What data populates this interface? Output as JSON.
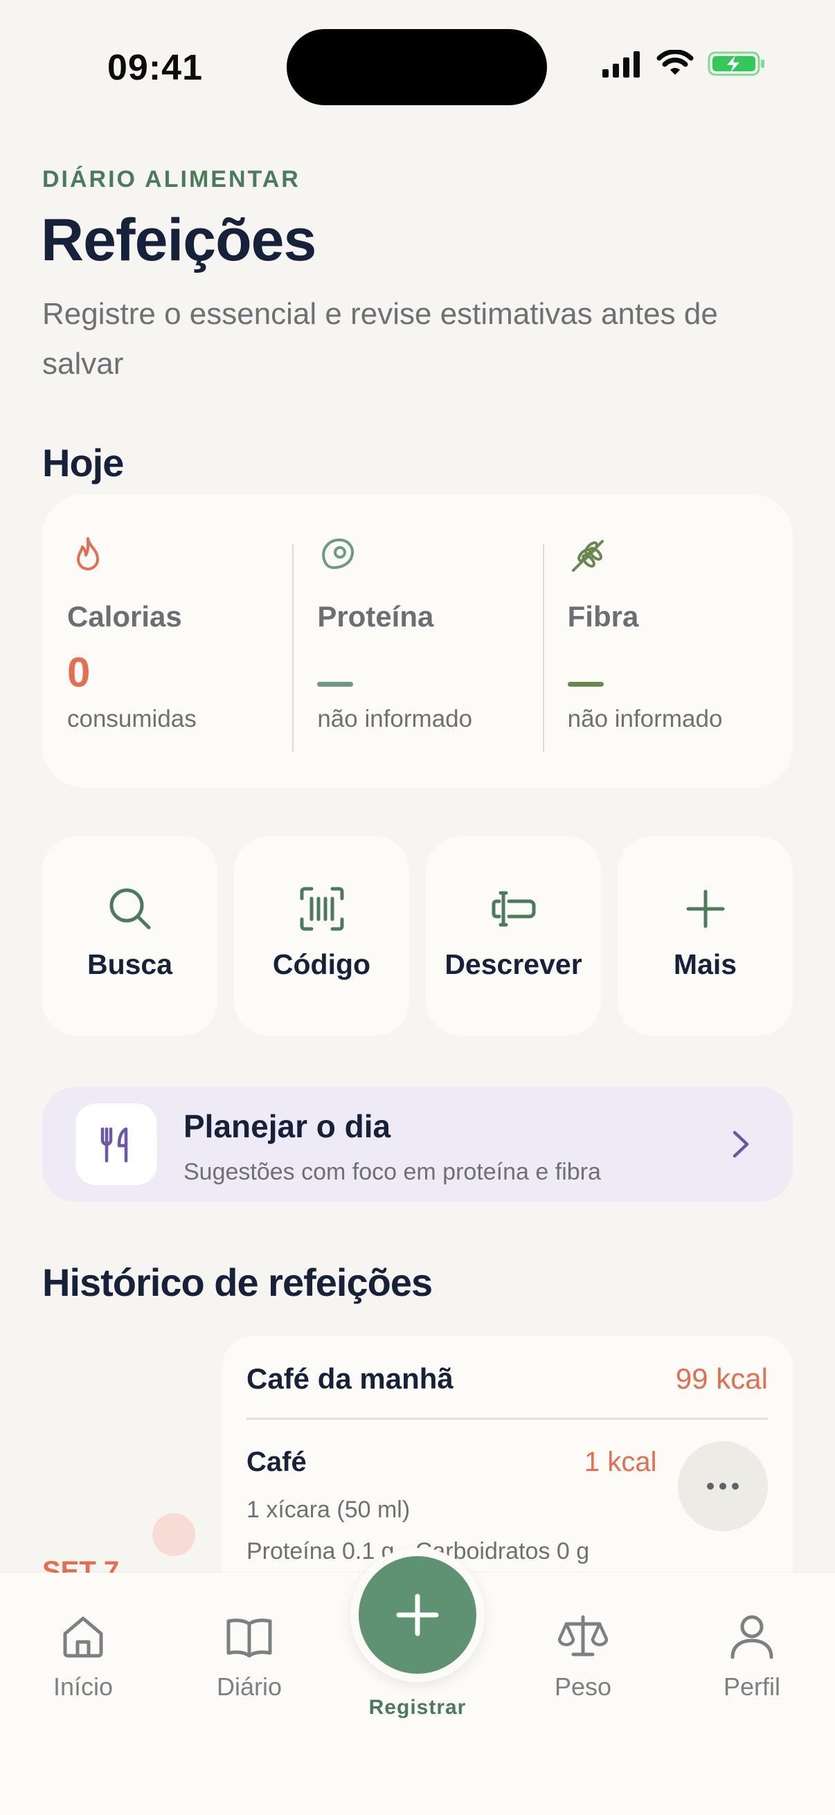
{
  "status_bar": {
    "time": "09:41"
  },
  "header": {
    "eyebrow": "DIÁRIO ALIMENTAR",
    "title": "Refeições",
    "subtitle": "Registre o essencial e revise estimativas antes de salvar"
  },
  "today": {
    "section_title": "Hoje",
    "metrics": [
      {
        "label": "Calorias",
        "value": "0",
        "sub": "consumidas",
        "icon": "flame-icon",
        "color": "#e36f50"
      },
      {
        "label": "Proteína",
        "value": "",
        "sub": "não informado",
        "icon": "meat-icon",
        "color": "#6f9a80"
      },
      {
        "label": "Fibra",
        "value": "",
        "sub": "não informado",
        "icon": "wheat-icon",
        "color": "#6a8750"
      }
    ]
  },
  "actions": [
    {
      "label": "Busca",
      "icon": "search-icon"
    },
    {
      "label": "Código",
      "icon": "barcode-scan-icon"
    },
    {
      "label": "Descrever",
      "icon": "text-cursor-icon"
    },
    {
      "label": "Mais",
      "icon": "plus-icon"
    }
  ],
  "plan": {
    "title": "Planejar o dia",
    "subtitle": "Sugestões com foco em proteína e fibra",
    "icon": "utensils-icon"
  },
  "history": {
    "section_title": "Histórico de refeições",
    "date_label": "SET 7",
    "meal": {
      "name": "Café da manhã",
      "kcal": "99 kcal",
      "items": [
        {
          "name": "Café",
          "kcal": "1 kcal",
          "portion": "1 xícara (50 ml)",
          "macros": "Proteína 0.1 g · Carboidratos 0 g"
        }
      ]
    }
  },
  "nav": {
    "items": [
      {
        "label": "Início",
        "icon": "home-icon"
      },
      {
        "label": "Diário",
        "icon": "book-icon"
      },
      {
        "label": "Peso",
        "icon": "scale-icon"
      },
      {
        "label": "Perfil",
        "icon": "user-icon"
      }
    ],
    "fab_label": "Registrar"
  },
  "colors": {
    "accent": "#5e9273",
    "calories": "#e36f50",
    "text": "#16213a",
    "plan_bg": "#eeeaf6"
  }
}
